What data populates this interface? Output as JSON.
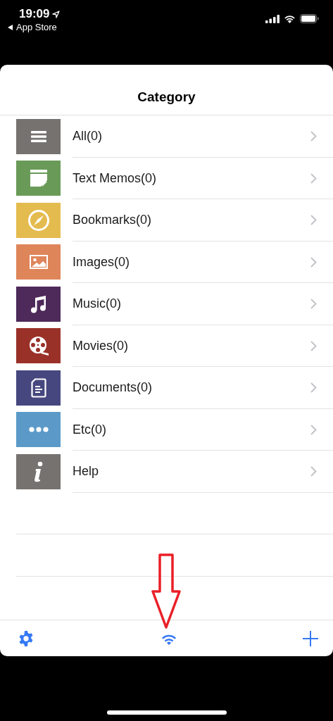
{
  "status_bar": {
    "time": "19:09",
    "back_label": "App Store"
  },
  "title": "Category",
  "categories": [
    {
      "label": "All(0)",
      "kind": "list",
      "color": "#757270"
    },
    {
      "label": "Text Memos(0)",
      "kind": "memo",
      "color": "#6a9a58"
    },
    {
      "label": "Bookmarks(0)",
      "kind": "compass",
      "color": "#e4bb4e"
    },
    {
      "label": "Images(0)",
      "kind": "image",
      "color": "#df855a"
    },
    {
      "label": "Music(0)",
      "kind": "music",
      "color": "#4e2a5a"
    },
    {
      "label": "Movies(0)",
      "kind": "film",
      "color": "#9a3129"
    },
    {
      "label": "Documents(0)",
      "kind": "document",
      "color": "#46477f"
    },
    {
      "label": "Etc(0)",
      "kind": "more",
      "color": "#5b9ac8"
    },
    {
      "label": "Help",
      "kind": "info",
      "color": "#757270"
    }
  ]
}
